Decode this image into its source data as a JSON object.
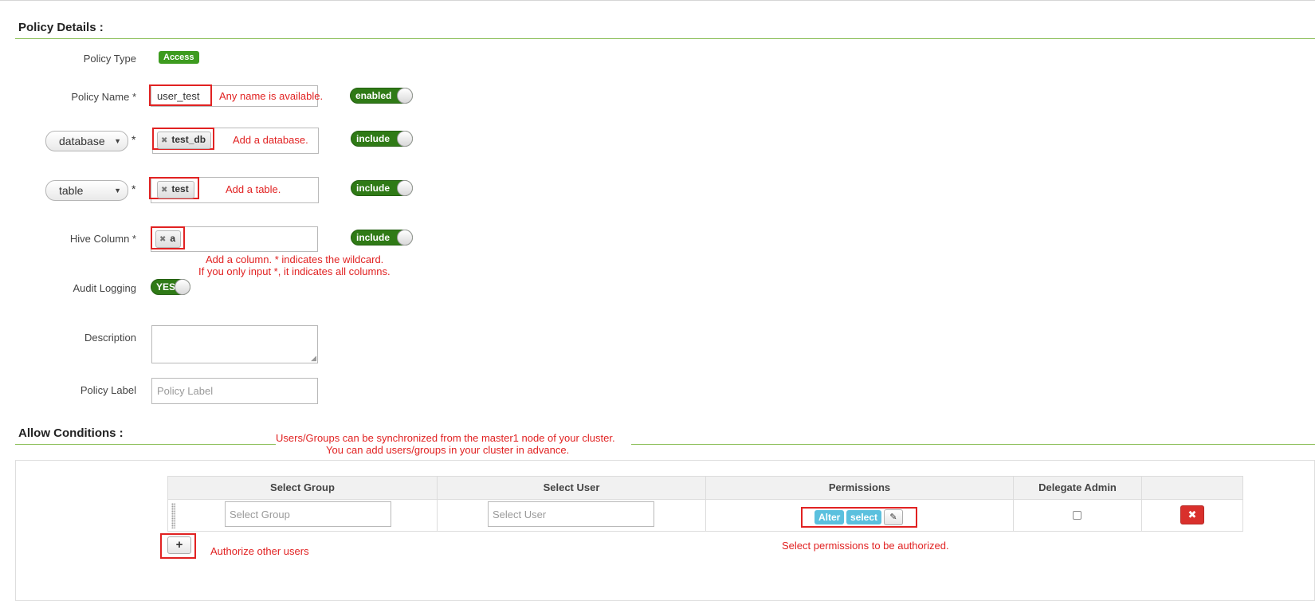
{
  "policy_details": {
    "title": "Policy Details :",
    "policy_type": {
      "label": "Policy Type",
      "badge": "Access"
    },
    "policy_name": {
      "label": "Policy Name *",
      "value": "user_test",
      "note": "Any name is available.",
      "toggle": "enabled"
    },
    "database": {
      "select": "database",
      "required": "*",
      "tag": "test_db",
      "note": "Add a database.",
      "toggle": "include"
    },
    "table": {
      "select": "table",
      "required": "*",
      "tag": "test",
      "note": "Add a table.",
      "toggle": "include"
    },
    "hive_column": {
      "label": "Hive Column *",
      "tag": "a",
      "note_line1": "Add a column. * indicates the wildcard.",
      "note_line2": "If you only input *, it indicates all columns.",
      "toggle": "include"
    },
    "audit_logging": {
      "label": "Audit Logging",
      "toggle": "YES"
    },
    "description": {
      "label": "Description",
      "value": ""
    },
    "policy_label": {
      "label": "Policy Label",
      "placeholder": "Policy Label"
    }
  },
  "allow_conditions": {
    "title": "Allow Conditions :",
    "note_line1": "Users/Groups can be synchronized from the master1 node of your cluster.",
    "note_line2": "You can add users/groups in your cluster in advance.",
    "columns": [
      "Select Group",
      "Select User",
      "Permissions",
      "Delegate Admin",
      ""
    ],
    "row": {
      "group_placeholder": "Select Group",
      "user_placeholder": "Select User",
      "permissions": [
        "Alter",
        "select"
      ],
      "edit_icon": "pencil-icon",
      "delete_icon": "close-icon"
    },
    "add_icon": "plus-icon",
    "add_note": "Authorize other users",
    "perm_note": "Select permissions to be authorized."
  },
  "colors": {
    "accent_green": "#3d9b1f",
    "toggle_green": "#2f7a16",
    "annotation_red": "#e12222",
    "permission_blue": "#5bc0de",
    "delete_red": "#d9302c"
  }
}
